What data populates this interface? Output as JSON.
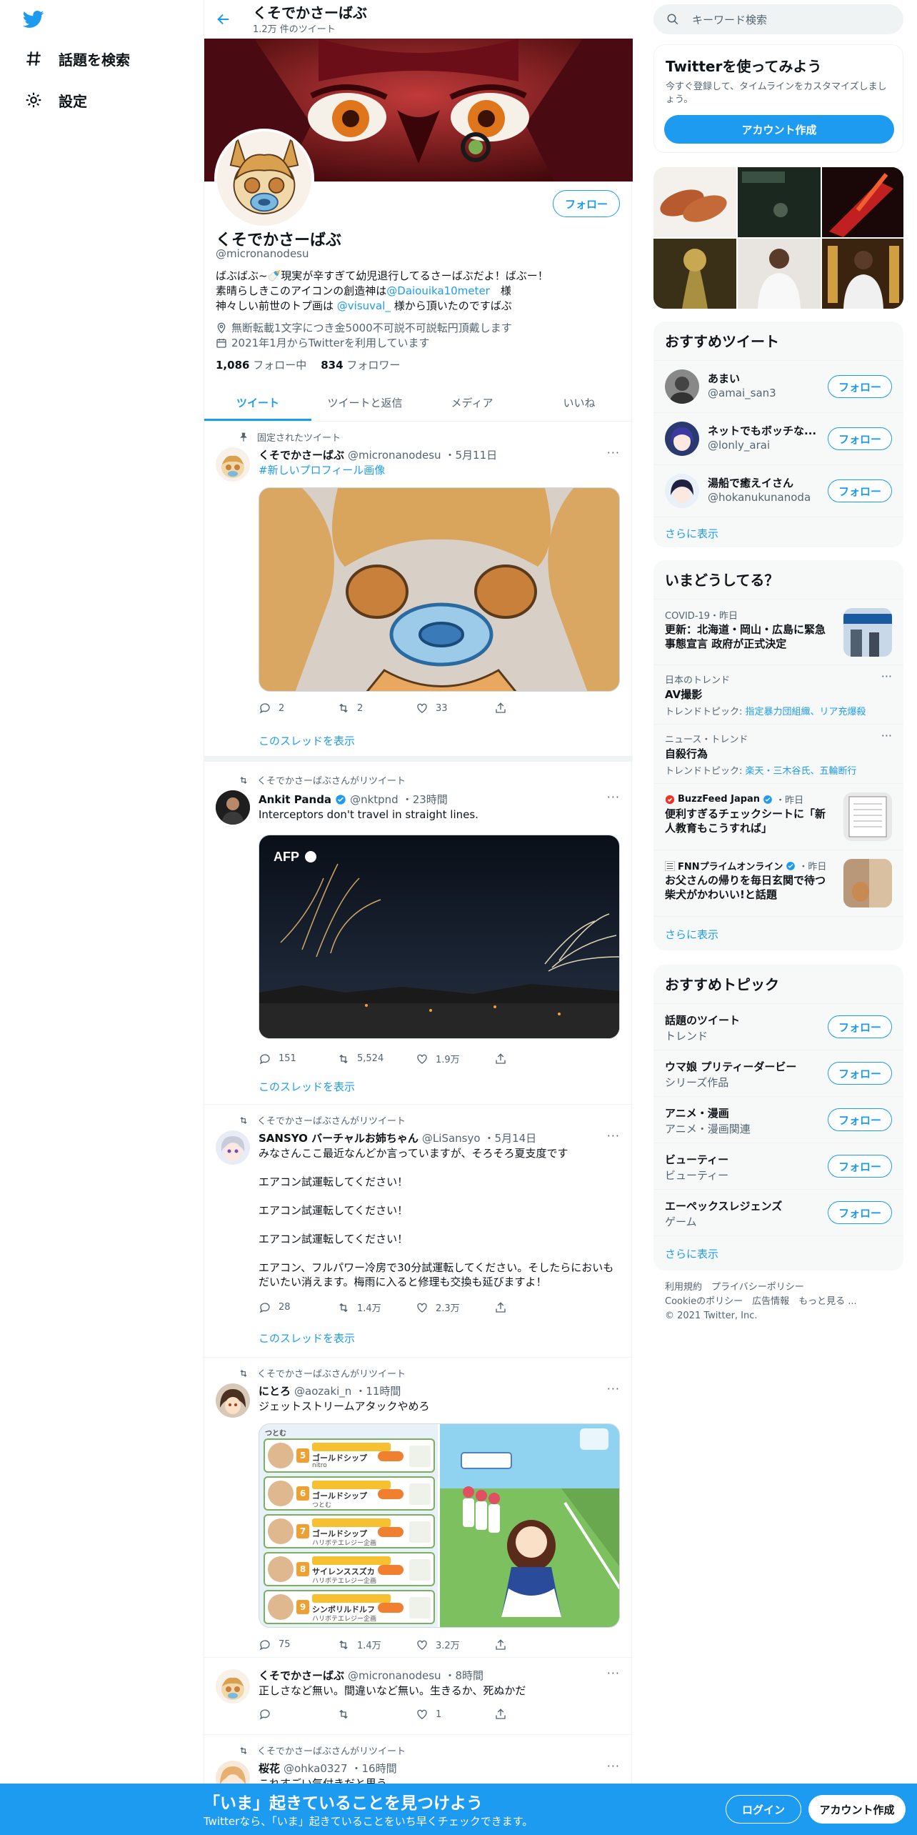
{
  "nav": {
    "explore_label": "話題を検索",
    "settings_label": "設定"
  },
  "header": {
    "name": "くそでかさーばぶ",
    "tweet_count": "1.2万 件のツイート"
  },
  "profile": {
    "follow_label": "フォロー",
    "name": "くそでかさーばぶ",
    "handle": "@micronanodesu",
    "bio_line1": "ばぶばぶ~🍼現実が辛すぎて幼児退行してるさーばぶだよ！ばぶー！",
    "bio_line2_pre": "素晴らしきこのアイコンの創造神は",
    "bio_line2_link": "@Daiouika10meter",
    "bio_line2_post": "　様",
    "bio_line3_pre": "神々しい前世のトプ画は",
    "bio_line3_link": "@visuval_",
    "bio_line3_post": "様から頂いたのですばぶ",
    "location": "無断転載1文字につき金5000不可説不可説転円頂戴します",
    "joined": "2021年1月からTwitterを利用しています",
    "following_count": "1,086",
    "following_label": "フォロー中",
    "followers_count": "834",
    "followers_label": "フォロワー"
  },
  "tabs": [
    "ツイート",
    "ツイートと返信",
    "メディア",
    "いいね"
  ],
  "tweets": [
    {
      "context": "固定されたツイート",
      "name": "くそでかさーばぶ",
      "handle": "@micronanodesu",
      "time": "・5月11日",
      "text": "#新しいプロフィール画像",
      "replies": "2",
      "retweets": "2",
      "likes": "33",
      "thread": "このスレッドを表示"
    },
    {
      "context": "くそでかさーばぶさんがリツイート",
      "name": "Ankit Panda",
      "handle": "@nktpnd",
      "time": "・23時間",
      "text": "Interceptors don't travel in straight lines.",
      "media_label": "AFP",
      "replies": "151",
      "retweets": "5,524",
      "likes": "1.9万",
      "thread": "このスレッドを表示"
    },
    {
      "context": "くそでかさーばぶさんがリツイート",
      "name": "SANSYO バーチャルお姉ちゃん",
      "handle": "@LiSansyo",
      "time": "・5月14日",
      "text_lines": [
        "みなさんここ最近なんどか言っていますが、そろそろ夏支度です",
        "",
        "エアコン試運転してください！",
        "",
        "エアコン試運転してください！",
        "",
        "エアコン試運転してください！",
        "",
        "エアコン、フルパワー冷房で30分試運転してください。そしたらにおいも",
        "だいたい消えます。梅雨に入ると修理も交換も延びますよ！"
      ],
      "replies": "28",
      "retweets": "1.4万",
      "likes": "2.3万",
      "thread": "このスレッドを表示"
    },
    {
      "context": "くそでかさーばぶさんがリツイート",
      "name": "にとろ",
      "handle": "@aozaki_n",
      "time": "・11時間",
      "text": "ジェットストリームアタックやめろ",
      "game_rows": [
        {
          "rank": "5",
          "title": "ゴールドシップ",
          "sub": "nitro"
        },
        {
          "rank": "6",
          "title": "ゴールドシップ",
          "sub": "つとむ"
        },
        {
          "rank": "7",
          "title": "ゴールドシップ",
          "sub": "ハリボテエレジー企画"
        },
        {
          "rank": "8",
          "title": "サイレンススズカ",
          "sub": "ハリボテエレジー企画"
        },
        {
          "rank": "9",
          "title": "シンボリルドルフ",
          "sub": "ハリボテエレジー企画"
        }
      ],
      "replies": "75",
      "retweets": "1.4万",
      "likes": "3.2万"
    },
    {
      "name": "くそでかさーばぶ",
      "handle": "@micronanodesu",
      "time": "・8時間",
      "text": "正しさなど無い。間違いなど無い。生きるか、死ぬかだ",
      "likes": "1"
    },
    {
      "context": "くそでかさーばぶさんがリツイート",
      "name": "桜花",
      "handle": "@ohka0327",
      "time": "・16時間",
      "text": "これすごい気付きだと思う"
    }
  ],
  "right": {
    "search_placeholder": "キーワード検索",
    "signup_title": "Twitterを使ってみよう",
    "signup_desc": "今すぐ登録して、タイムラインをカスタマイズしましょう。",
    "signup_button": "アカウント作成",
    "who_title": "おすすめツイート",
    "who": [
      {
        "name": "あまい",
        "handle": "@amai_san3",
        "button": "フォロー"
      },
      {
        "name": "ネットでもボッチな...",
        "handle": "@lonly_arai",
        "button": "フォロー"
      },
      {
        "name": "湯船で癒えイさん",
        "handle": "@hokanukunanoda",
        "button": "フォロー"
      }
    ],
    "who_more": "さらに表示",
    "trends_title": "いまどうしてる？",
    "trends": [
      {
        "meta": "COVID-19・昨日",
        "title": "更新：北海道・岡山・広島に緊急事態宣言 政府が正式決定"
      },
      {
        "meta": "日本のトレンド",
        "title": "AV撮影",
        "sub_pre": "トレンドトピック: ",
        "sub_link": "指定暴力団組織、リア充爆殺"
      },
      {
        "meta": "ニュース・トレンド",
        "title": "自殺行為",
        "sub_pre": "トレンドトピック: ",
        "sub_link": "楽天・三木谷氏、五輪断行"
      },
      {
        "meta_source": "BuzzFeed Japan",
        "meta_time": "・昨日",
        "title": "便利すぎるチェックシートに「新人教育もこうすれば」"
      },
      {
        "meta_source": "FNNプライムオンライン",
        "meta_time": "・昨日",
        "title": "お父さんの帰りを毎日玄関で待つ柴犬がかわいい!と話題"
      }
    ],
    "trends_more": "さらに表示",
    "topics_title": "おすすめトピック",
    "topics": [
      {
        "name": "話題のツイート",
        "category": "トレンド",
        "button": "フォロー"
      },
      {
        "name": "ウマ娘 プリティーダービー",
        "category": "シリーズ作品",
        "button": "フォロー"
      },
      {
        "name": "アニメ・漫画",
        "category": "アニメ・漫画関連",
        "button": "フォロー"
      },
      {
        "name": "ビューティー",
        "category": "ビューティー",
        "button": "フォロー"
      },
      {
        "name": "エーペックスレジェンズ",
        "category": "ゲーム",
        "button": "フォロー"
      }
    ],
    "topics_more": "さらに表示",
    "footer_line1": "利用規約　プライバシーポリシー",
    "footer_line2": "Cookieのポリシー　広告情報　もっと見る ...",
    "footer_line3": "© 2021 Twitter, Inc."
  },
  "bottom": {
    "title": "「いま」起きていることを見つけよう",
    "subtitle": "Twitterなら、「いま」起きていることをいち早くチェックできます。",
    "login": "ログイン",
    "signup": "アカウント作成"
  },
  "colors": {
    "accent": "#1d9bf0",
    "text": "#0f1419",
    "muted": "#536471"
  }
}
